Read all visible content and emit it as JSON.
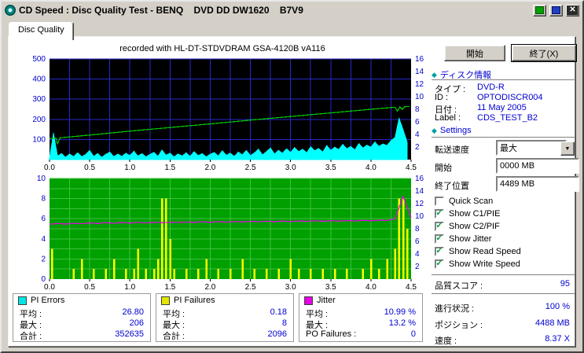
{
  "window": {
    "title": "CD Speed : Disc Quality Test - BENQ    DVD DD DW1620    B7V9"
  },
  "icons": {
    "close": "✕",
    "combo_arrow": "▼",
    "section_bullet": "◆",
    "check": "✓"
  },
  "tab": {
    "label": "Disc Quality"
  },
  "chart_header": "recorded with HL-DT-STDVDRAM GSA-4120B vA116",
  "chart_data": [
    {
      "type": "area",
      "name": "PI Errors / Write Speed",
      "x_range": [
        0,
        4.5
      ],
      "x_tick_step": 0.5,
      "x_ticks": [
        "0.0",
        "0.5",
        "1.0",
        "1.5",
        "2.0",
        "2.5",
        "3.0",
        "3.5",
        "4.0",
        "4.5"
      ],
      "left_axis": {
        "range": [
          0,
          500
        ],
        "ticks": [
          100,
          200,
          300,
          400,
          500
        ]
      },
      "right_axis": {
        "range": [
          0,
          16
        ],
        "ticks": [
          2,
          4,
          6,
          8,
          10,
          12,
          14,
          16
        ]
      },
      "bg": "#000000",
      "grid": {
        "x_step": 0.25,
        "y_step": 100,
        "color": "#2828c8"
      },
      "axis_color": "#0000c8",
      "x_axis_color": "#000000",
      "series": [
        {
          "name": "PI Errors",
          "type": "area",
          "axis": "left",
          "color": "#00ffff",
          "x_start": 0,
          "x_step": 0.05,
          "y": [
            8,
            132,
            18,
            30,
            12,
            28,
            15,
            34,
            14,
            26,
            45,
            16,
            30,
            12,
            26,
            38,
            14,
            28,
            16,
            32,
            20,
            42,
            18,
            30,
            14,
            26,
            36,
            16,
            48,
            22,
            32,
            14,
            28,
            18,
            34,
            16,
            40,
            20,
            30,
            14,
            26,
            36,
            18,
            44,
            22,
            32,
            16,
            38,
            24,
            46,
            20,
            34,
            52,
            24,
            40,
            58,
            28,
            46,
            32,
            54,
            36,
            60,
            40,
            52,
            34,
            64,
            44,
            56,
            38,
            70,
            46,
            62,
            50,
            76,
            54,
            66,
            48,
            80,
            58,
            72,
            62,
            88,
            66,
            78,
            70,
            94,
            110,
            206,
            150,
            88
          ]
        },
        {
          "name": "Write Speed",
          "type": "line",
          "axis": "right",
          "color": "#00cc00",
          "points": [
            [
              0,
              3.35
            ],
            [
              0.08,
              3.42
            ],
            [
              0.1,
              2.5
            ],
            [
              0.13,
              3.46
            ],
            [
              0.5,
              3.9
            ],
            [
              1.0,
              4.52
            ],
            [
              1.5,
              5.1
            ],
            [
              2.0,
              5.68
            ],
            [
              2.5,
              6.27
            ],
            [
              3.0,
              6.85
            ],
            [
              3.5,
              7.43
            ],
            [
              4.0,
              8.0
            ],
            [
              4.25,
              8.28
            ],
            [
              4.3,
              8.33
            ],
            [
              4.33,
              7.7
            ],
            [
              4.36,
              8.37
            ],
            [
              4.39,
              8.0
            ],
            [
              4.42,
              8.4
            ],
            [
              4.48,
              8.45
            ]
          ]
        }
      ]
    },
    {
      "type": "bar",
      "name": "PI Failures / Jitter",
      "x_range": [
        0,
        4.5
      ],
      "x_tick_step": 0.5,
      "x_ticks": [
        "0.0",
        "0.5",
        "1.0",
        "1.5",
        "2.0",
        "2.5",
        "3.0",
        "3.5",
        "4.0",
        "4.5"
      ],
      "left_axis": {
        "range": [
          0,
          10
        ],
        "ticks": [
          0,
          2,
          4,
          6,
          8,
          10
        ]
      },
      "right_axis": {
        "range": [
          0,
          16
        ],
        "ticks": [
          2,
          4,
          6,
          8,
          10,
          12,
          14,
          16
        ]
      },
      "bg": "#00a000",
      "grid": {
        "x_step": 0.25,
        "y_step": 1,
        "color": "#40c040"
      },
      "axis_color": "#0000c8",
      "x_axis_color": "#000000",
      "series": [
        {
          "name": "PI Failures",
          "type": "bars",
          "axis": "left",
          "color": "#ffff00",
          "bars": [
            [
              0.03,
              3
            ],
            [
              0.3,
              1
            ],
            [
              0.4,
              2
            ],
            [
              0.55,
              1
            ],
            [
              0.7,
              1
            ],
            [
              0.8,
              2
            ],
            [
              0.95,
              1
            ],
            [
              1.05,
              1
            ],
            [
              1.1,
              3
            ],
            [
              1.2,
              1
            ],
            [
              1.3,
              1
            ],
            [
              1.35,
              2
            ],
            [
              1.4,
              8
            ],
            [
              1.45,
              8
            ],
            [
              1.5,
              4
            ],
            [
              1.55,
              1
            ],
            [
              1.7,
              1
            ],
            [
              1.85,
              1
            ],
            [
              1.95,
              2
            ],
            [
              2.1,
              1
            ],
            [
              2.25,
              1
            ],
            [
              2.4,
              2
            ],
            [
              2.55,
              1
            ],
            [
              2.7,
              1
            ],
            [
              2.85,
              1
            ],
            [
              3.0,
              2
            ],
            [
              3.1,
              1
            ],
            [
              3.25,
              1
            ],
            [
              3.4,
              1
            ],
            [
              3.55,
              1
            ],
            [
              3.7,
              1
            ],
            [
              3.9,
              1
            ],
            [
              4.0,
              2
            ],
            [
              4.1,
              1
            ],
            [
              4.2,
              2
            ],
            [
              4.3,
              3
            ],
            [
              4.35,
              8
            ],
            [
              4.4,
              8
            ],
            [
              4.45,
              5
            ]
          ]
        },
        {
          "name": "Jitter",
          "type": "line",
          "axis": "left",
          "color": "#ee00ee",
          "x_start": 0,
          "x_step": 0.1,
          "y": [
            5.45,
            5.52,
            5.48,
            5.55,
            5.5,
            5.58,
            5.52,
            5.6,
            5.55,
            5.62,
            5.56,
            5.64,
            5.58,
            5.65,
            5.6,
            5.66,
            5.62,
            5.68,
            5.63,
            5.7,
            5.64,
            5.72,
            5.66,
            5.73,
            5.68,
            5.74,
            5.7,
            5.76,
            5.71,
            5.77,
            5.72,
            5.78,
            5.74,
            5.8,
            5.75,
            5.81,
            5.76,
            5.82,
            5.78,
            5.84,
            5.8,
            5.86,
            5.82,
            6.0,
            8.2,
            6.1
          ]
        }
      ]
    }
  ],
  "panels": {
    "pi_errors": {
      "title": "PI Errors",
      "color": "#00e5e5",
      "rows": [
        {
          "label": "平均 :",
          "value": "26.80"
        },
        {
          "label": "最大 :",
          "value": "206"
        },
        {
          "label": "合計 :",
          "value": "352635"
        }
      ]
    },
    "pi_failures": {
      "title": "PI Failures",
      "color": "#e5e500",
      "rows": [
        {
          "label": "平均 :",
          "value": "0.18"
        },
        {
          "label": "最大 :",
          "value": "8"
        },
        {
          "label": "合計 :",
          "value": "2096"
        }
      ]
    },
    "jitter": {
      "title": "Jitter",
      "color": "#e500e5",
      "rows": [
        {
          "label": "平均 :",
          "value": "10.99 %"
        },
        {
          "label": "最大 :",
          "value": "13.2 %"
        },
        {
          "label": "PO Failures :",
          "value": "0"
        }
      ]
    }
  },
  "sidebar": {
    "start_button": "開始",
    "exit_button": "終了(X)",
    "disc_info": {
      "title": "ディスク情報",
      "rows": [
        {
          "label": "タイプ :",
          "value": "DVD-R"
        },
        {
          "label": "ID :",
          "value": "OPTODISCR004"
        },
        {
          "label": "日付 :",
          "value": "11 May 2005"
        },
        {
          "label": "Label :",
          "value": "CDS_TEST_B2"
        }
      ]
    },
    "settings": {
      "title": "Settings",
      "speed_label": "転送速度",
      "speed_value": "最大",
      "start_label": "開始",
      "start_value": "0000 MB",
      "end_label": "終了位置",
      "end_value": "4489 MB"
    },
    "checkboxes": [
      {
        "label": "Quick Scan",
        "checked": false
      },
      {
        "label": "Show C1/PIE",
        "checked": true
      },
      {
        "label": "Show C2/PIF",
        "checked": true
      },
      {
        "label": "Show Jitter",
        "checked": true
      },
      {
        "label": "Show Read Speed",
        "checked": true
      },
      {
        "label": "Show Write Speed",
        "checked": true
      }
    ],
    "quality": {
      "label": "品質スコア :",
      "value": "95"
    },
    "progress": [
      {
        "label": "進行状況 :",
        "value": "100 %"
      },
      {
        "label": "ポジション :",
        "value": "4488 MB"
      },
      {
        "label": "速度 :",
        "value": "8.37 X"
      }
    ]
  }
}
